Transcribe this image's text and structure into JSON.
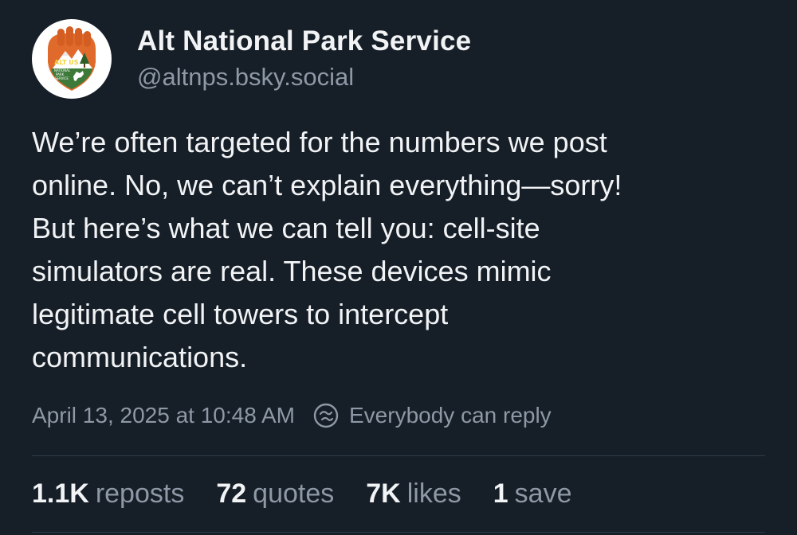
{
  "author": {
    "display_name": "Alt National Park Service",
    "handle": "@altnps.bsky.social",
    "avatar_icon": "alt-national-park-service-logo",
    "avatar_text": [
      "ALT US",
      "NATIONAL",
      "PARK",
      "SERVICE"
    ]
  },
  "post": {
    "text": "We’re often targeted for the numbers we post\nonline. No, we can’t explain everything—sorry!\nBut here’s what we can tell you: cell-site\nsimulators are real. These devices mimic\nlegitimate cell towers to intercept\ncommunications."
  },
  "meta": {
    "timestamp": "April 13, 2025 at 10:48 AM",
    "reply_icon": "reply-settings-icon",
    "reply_setting": "Everybody can reply"
  },
  "stats": [
    {
      "count": "1.1K",
      "label": "reposts"
    },
    {
      "count": "72",
      "label": "quotes"
    },
    {
      "count": "7K",
      "label": "likes"
    },
    {
      "count": "1",
      "label": "save"
    }
  ],
  "colors": {
    "background": "#161e27",
    "text": "#f1f3f5",
    "muted": "#8d99a6",
    "divider": "#2e3b48",
    "logo_orange": "#e06a2b",
    "logo_green": "#3d7a3a"
  }
}
